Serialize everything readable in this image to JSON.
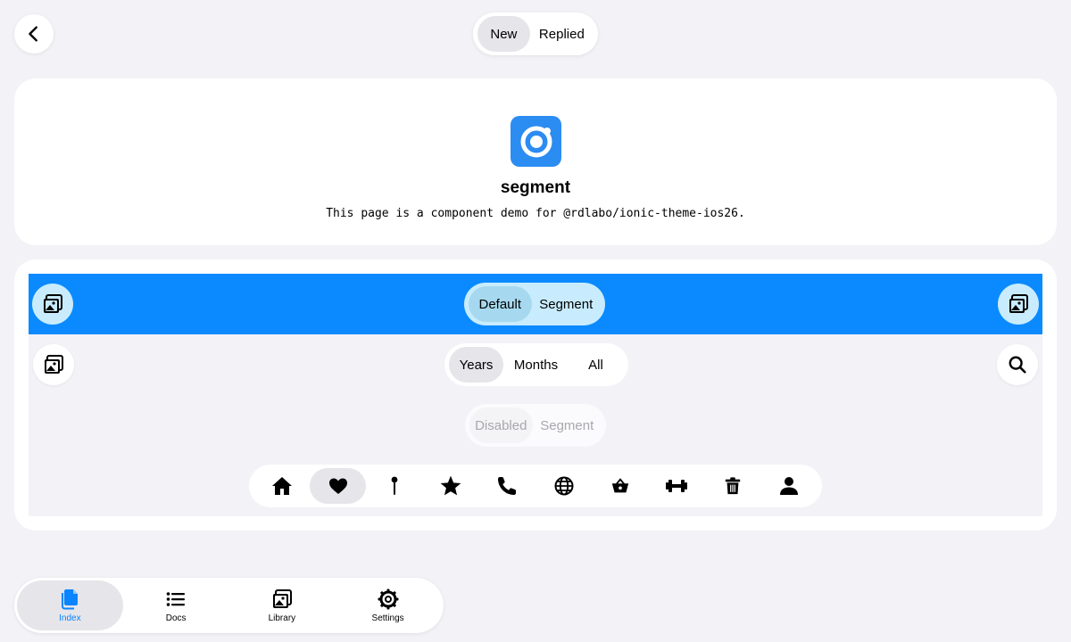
{
  "header": {
    "back_icon": "chevron-left-icon",
    "segment": [
      {
        "label": "New",
        "active": true
      },
      {
        "label": "Replied",
        "active": false
      }
    ]
  },
  "intro": {
    "logo_icon": "ionic-logo-icon",
    "title": "segment",
    "description": "This page is a component demo for @rdlabo/ionic-theme-ios26."
  },
  "demo": {
    "toolbar_color": "#0a8afe",
    "toolbar_start_icon": "images-icon",
    "toolbar_end_icon": "images-icon",
    "toolbar_segment": [
      {
        "label": "Default",
        "active": true
      },
      {
        "label": "Segment",
        "active": false
      }
    ],
    "row2_start_icon": "images-icon",
    "row2_end_icon": "search-icon",
    "time_segment": [
      {
        "label": "Years",
        "active": true
      },
      {
        "label": "Months",
        "active": false
      },
      {
        "label": "All",
        "active": false
      }
    ],
    "disabled_segment": [
      {
        "label": "Disabled",
        "active": true
      },
      {
        "label": "Segment",
        "active": false
      }
    ],
    "icon_segment": [
      {
        "icon": "home-icon",
        "active": false
      },
      {
        "icon": "heart-icon",
        "active": true
      },
      {
        "icon": "pin-icon",
        "active": false
      },
      {
        "icon": "star-icon",
        "active": false
      },
      {
        "icon": "call-icon",
        "active": false
      },
      {
        "icon": "globe-icon",
        "active": false
      },
      {
        "icon": "basket-icon",
        "active": false
      },
      {
        "icon": "barbell-icon",
        "active": false
      },
      {
        "icon": "trash-icon",
        "active": false
      },
      {
        "icon": "person-icon",
        "active": false
      }
    ]
  },
  "tabs": [
    {
      "label": "Index",
      "icon": "documents-icon",
      "active": true
    },
    {
      "label": "Docs",
      "icon": "list-icon",
      "active": false
    },
    {
      "label": "Library",
      "icon": "images-icon",
      "active": false
    },
    {
      "label": "Settings",
      "icon": "cog-icon",
      "active": false
    }
  ],
  "colors": {
    "accent": "#0a84ff",
    "background": "#f2f2f7",
    "toolbar_blue": "#0a8afe",
    "toolbar_segment_bg": "#c8ecfd"
  }
}
